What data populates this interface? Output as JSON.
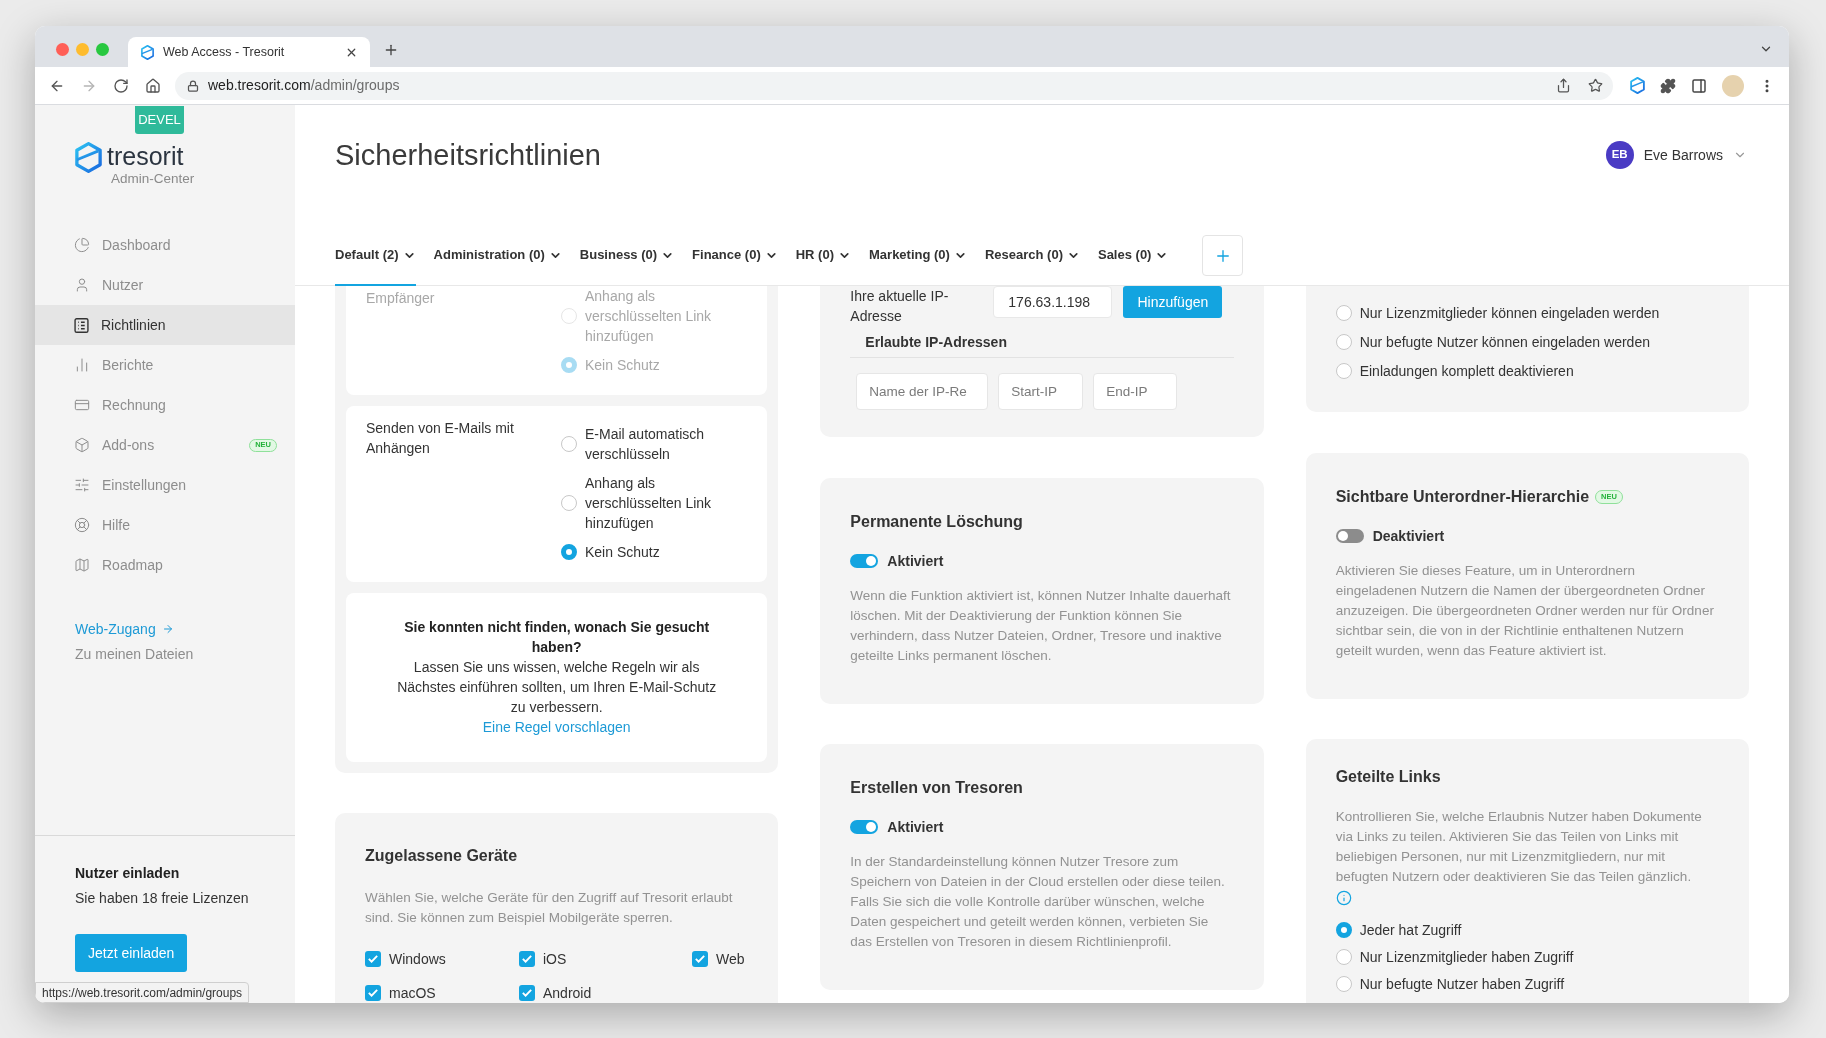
{
  "browser": {
    "tab_title": "Web Access - Tresorit",
    "url_host": "web.tresorit.com",
    "url_path": "/admin/groups"
  },
  "sidebar": {
    "environment": "DEVEL",
    "logo": "tresorit",
    "subtitle": "Admin-Center",
    "items": [
      {
        "label": "Dashboard",
        "selected": false
      },
      {
        "label": "Nutzer",
        "selected": false
      },
      {
        "label": "Richtlinien",
        "selected": true
      },
      {
        "label": "Berichte",
        "selected": false
      },
      {
        "label": "Rechnung",
        "selected": false
      },
      {
        "label": "Add-ons",
        "selected": false,
        "badge": "NEU"
      },
      {
        "label": "Einstellungen",
        "selected": false
      },
      {
        "label": "Hilfe",
        "selected": false
      },
      {
        "label": "Roadmap",
        "selected": false
      }
    ],
    "web_access": {
      "link": "Web-Zugang",
      "subtitle": "Zu meinen Dateien"
    },
    "invite": {
      "title": "Nutzer einladen",
      "text": "Sie haben 18 freie Lizenzen",
      "button": "Jetzt einladen"
    }
  },
  "header": {
    "title": "Sicherheitsrichtlinien",
    "user": {
      "initials": "EB",
      "name": "Eve Barrows"
    }
  },
  "tabs": [
    {
      "label": "Default (2)",
      "selected": true
    },
    {
      "label": "Administration (0)",
      "selected": false
    },
    {
      "label": "Business (0)",
      "selected": false
    },
    {
      "label": "Finance (0)",
      "selected": false
    },
    {
      "label": "HR (0)",
      "selected": false
    },
    {
      "label": "Marketing (0)",
      "selected": false
    },
    {
      "label": "Research (0)",
      "selected": false
    },
    {
      "label": "Sales (0)",
      "selected": false
    }
  ],
  "email_rules": [
    {
      "label": "Empfänger",
      "disabled": true,
      "options": [
        {
          "label": "Anhang als verschlüsselten Link hinzufügen",
          "selected": false
        },
        {
          "label": "Kein Schutz",
          "selected": true
        }
      ]
    },
    {
      "label": "Senden von E-Mails mit Anhängen",
      "disabled": false,
      "options": [
        {
          "label": "E-Mail automatisch verschlüsseln",
          "selected": false
        },
        {
          "label": "Anhang als verschlüsselten Link hinzufügen",
          "selected": false
        },
        {
          "label": "Kein Schutz",
          "selected": true
        }
      ]
    }
  ],
  "suggestion": {
    "heading": "Sie konnten nicht finden, wonach Sie gesucht haben?",
    "text": "Lassen Sie uns wissen, welche Regeln wir als Nächstes einführen sollten, um Ihren E-Mail-Schutz zu verbessern.",
    "link": "Eine Regel vorschlagen"
  },
  "devices": {
    "title": "Zugelassene Geräte",
    "description": "Wählen Sie, welche Geräte für den Zugriff auf Tresorit erlaubt sind. Sie können zum Beispiel Mobilgeräte sperren.",
    "options": [
      {
        "label": "Windows",
        "checked": true
      },
      {
        "label": "iOS",
        "checked": true
      },
      {
        "label": "Web",
        "checked": true
      },
      {
        "label": "macOS",
        "checked": true
      },
      {
        "label": "Android",
        "checked": true
      }
    ]
  },
  "ip_restriction": {
    "current_ip_label": "Ihre aktuelle IP-Adresse",
    "current_ip": "176.63.1.198",
    "add_button": "Hinzufügen",
    "allowed_title": "Erlaubte IP-Adressen",
    "fields": [
      {
        "placeholder": "Name der IP-Re"
      },
      {
        "placeholder": "Start-IP"
      },
      {
        "placeholder": "End-IP"
      }
    ]
  },
  "permanent_deletion": {
    "title": "Permanente Löschung",
    "toggle": {
      "on": true,
      "label": "Aktiviert"
    },
    "description": "Wenn die Funktion aktiviert ist, können Nutzer Inhalte dauerhaft löschen. Mit der Deaktivierung der Funktion können Sie verhindern, dass Nutzer Dateien, Ordner, Tresore und inaktive geteilte Links permanent löschen."
  },
  "vault_creation": {
    "title": "Erstellen von Tresoren",
    "toggle": {
      "on": true,
      "label": "Aktiviert"
    },
    "description": "In der Standardeinstellung können Nutzer Tresore zum Speichern von Dateien in der Cloud erstellen oder diese teilen. Falls Sie sich die volle Kontrolle darüber wünschen, welche Daten gespeichert und geteilt werden können, verbieten Sie das Erstellen von Tresoren in diesem Richtlinienprofil."
  },
  "invitations": {
    "options": [
      {
        "label": "Nur Lizenzmitglieder können eingeladen werden",
        "selected": false
      },
      {
        "label": "Nur befugte Nutzer können eingeladen werden",
        "selected": false
      },
      {
        "label": "Einladungen komplett deaktivieren",
        "selected": false
      }
    ]
  },
  "subfolder_hierarchy": {
    "title": "Sichtbare Unterordner-Hierarchie",
    "badge": "NEU",
    "toggle": {
      "on": false,
      "label": "Deaktiviert"
    },
    "description": "Aktivieren Sie dieses Feature, um in Unterordnern eingeladenen Nutzern die Namen der übergeordneten Ordner anzuzeigen. Die übergeordneten Ordner werden nur für Ordner sichtbar sein, die von in der Richtlinie enthaltenen Nutzern geteilt wurden, wenn das Feature aktiviert ist."
  },
  "shared_links": {
    "title": "Geteilte Links",
    "description": "Kontrollieren Sie, welche Erlaubnis Nutzer haben Dokumente via Links zu teilen. Aktivieren Sie das Teilen von Links mit beliebigen Personen, nur mit Lizenzmitgliedern, nur mit befugten Nutzern oder deaktivieren Sie das Teilen gänzlich.",
    "options": [
      {
        "label": "Jeder hat Zugriff",
        "selected": true
      },
      {
        "label": "Nur Lizenzmitglieder haben Zugriff",
        "selected": false
      },
      {
        "label": "Nur befugte Nutzer haben Zugriff",
        "selected": false
      }
    ]
  },
  "status_url": "https://web.tresorit.com/admin/groups"
}
